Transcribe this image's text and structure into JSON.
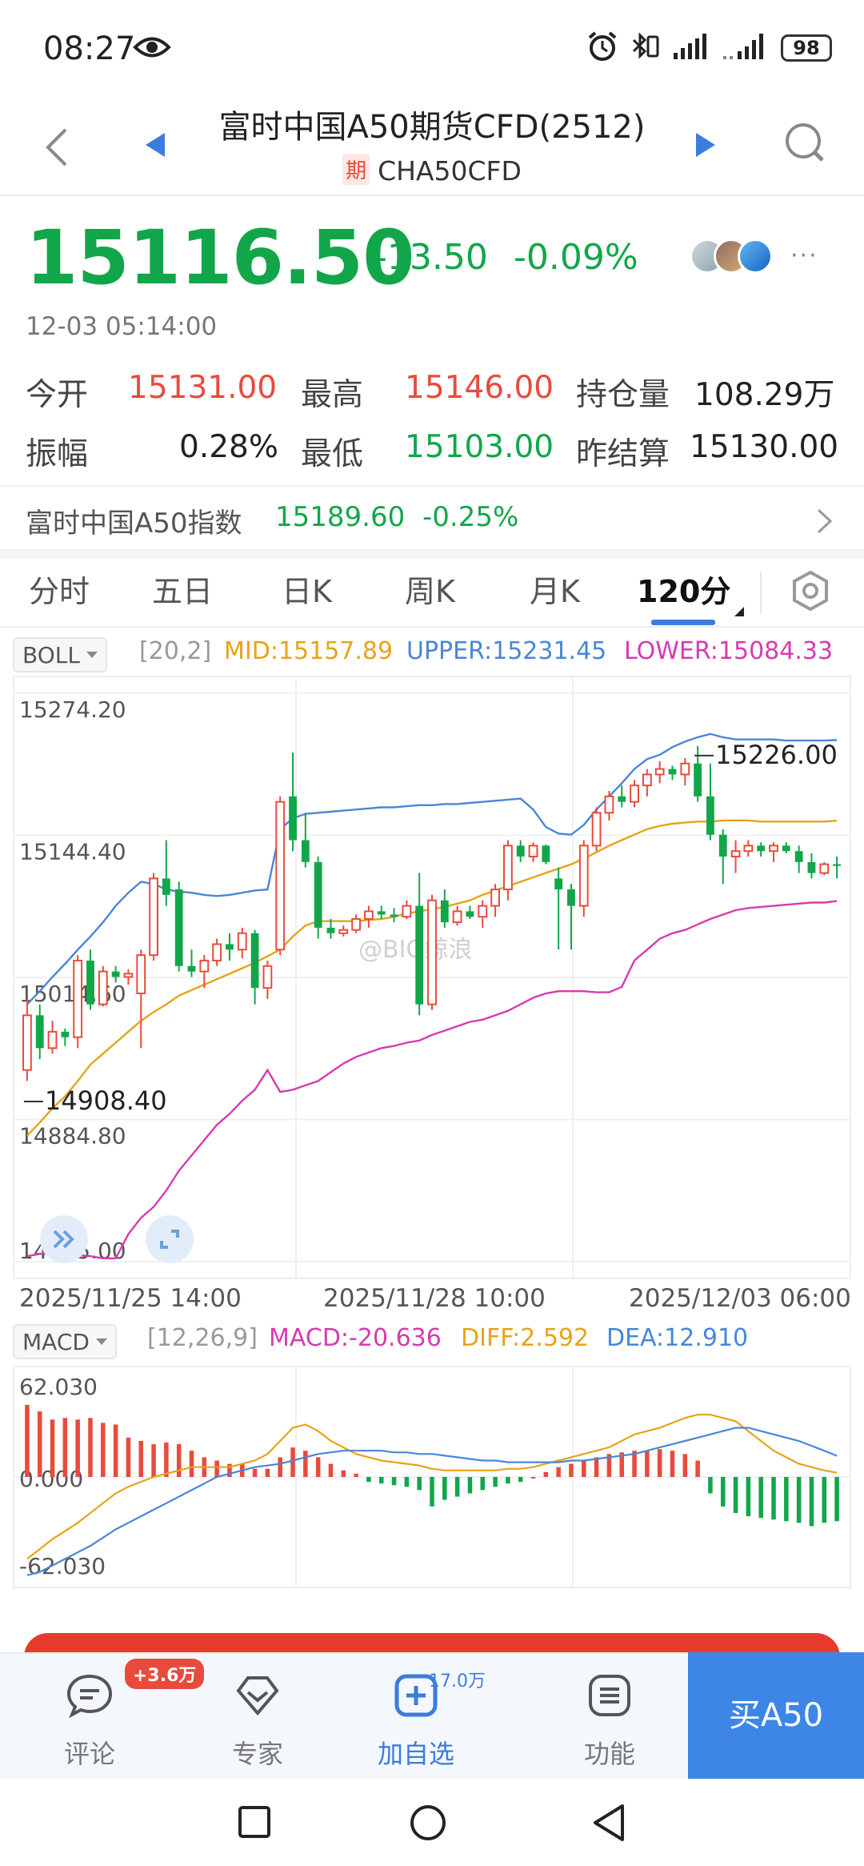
{
  "status_bar": {
    "time": "08:27",
    "battery": "98",
    "icons": [
      "eye-icon",
      "alarm-icon",
      "bluetooth-icon",
      "signal-icon",
      "wifi-icon",
      "battery-icon"
    ]
  },
  "header": {
    "title": "富时中国A50期货CFD(2512)",
    "badge": "期",
    "symbol": "CHA50CFD",
    "icons": [
      "back-arrow-icon",
      "prev-triangle-icon",
      "next-triangle-icon",
      "search-icon"
    ]
  },
  "quote": {
    "price": "15116.50",
    "change": "-13.50",
    "change_pct": "-0.09%",
    "time": "12-03 05:14:00",
    "more": "···"
  },
  "stats": {
    "open_label": "今开",
    "open": "15131.00",
    "high_label": "最高",
    "high": "15146.00",
    "oi_label": "持仓量",
    "oi": "108.29万",
    "amp_label": "振幅",
    "amp": "0.28%",
    "low_label": "最低",
    "low": "15103.00",
    "settle_label": "昨结算",
    "settle": "15130.00"
  },
  "index": {
    "name": "富时中国A50指数",
    "value": "15189.60",
    "pct": "-0.25%"
  },
  "tabs": [
    "分时",
    "五日",
    "日K",
    "周K",
    "月K",
    "120分"
  ],
  "active_tab": "120分",
  "boll": {
    "selector": "BOLL",
    "params": "[20,2]",
    "mid": "MID:15157.89",
    "upper": "UPPER:15231.45",
    "lower": "LOWER:15084.33",
    "y_labels": [
      "15274.20",
      "15144.40",
      "15014.60",
      "14884.80",
      "14755.00"
    ],
    "annotations": {
      "high": "15226.00",
      "low": "14908.40"
    },
    "watermark": "@BIG鲸浪"
  },
  "x_axis": [
    "2025/11/25 14:00",
    "2025/11/28 10:00",
    "2025/12/03 06:00"
  ],
  "macd": {
    "selector": "MACD",
    "params": "[12,26,9]",
    "macd": "MACD:-20.636",
    "diff": "DIFF:2.592",
    "dea": "DEA:12.910",
    "y_labels": [
      "62.030",
      "0.000",
      "-62.030"
    ]
  },
  "colors": {
    "up": "#e84b3c",
    "down": "#11a64a",
    "mid": "#e8a317",
    "upper": "#4a86d8",
    "lower": "#d63bb0",
    "accent": "#3d86e6"
  },
  "chart_data": [
    {
      "type": "candlestick",
      "title": "",
      "ylim": [
        14755.0,
        15274.2
      ],
      "x_ticks": [
        "2025/11/25 14:00",
        "2025/11/28 10:00",
        "2025/12/03 06:00"
      ],
      "candles": [
        [
          14930,
          14995,
          14920,
          14980
        ],
        [
          14980,
          14990,
          14940,
          14950
        ],
        [
          14950,
          14975,
          14945,
          14965
        ],
        [
          14965,
          14968,
          14952,
          14960
        ],
        [
          14960,
          15035,
          14950,
          15030
        ],
        [
          15030,
          15040,
          14985,
          14990
        ],
        [
          14990,
          15025,
          14988,
          15020
        ],
        [
          15020,
          15025,
          15010,
          15015
        ],
        [
          15015,
          15022,
          15008,
          15018
        ],
        [
          15000,
          15040,
          14950,
          15035
        ],
        [
          15035,
          15110,
          15030,
          15105
        ],
        [
          15105,
          15140,
          15080,
          15090
        ],
        [
          15095,
          15102,
          15020,
          15025
        ],
        [
          15025,
          15040,
          15015,
          15020
        ],
        [
          15020,
          15035,
          15005,
          15030
        ],
        [
          15030,
          15050,
          15025,
          15045
        ],
        [
          15045,
          15055,
          15030,
          15040
        ],
        [
          15040,
          15060,
          15032,
          15055
        ],
        [
          15055,
          15058,
          14990,
          15005
        ],
        [
          15005,
          15030,
          14995,
          15025
        ],
        [
          15040,
          15180,
          15035,
          15175
        ],
        [
          15180,
          15220,
          15130,
          15140
        ],
        [
          15140,
          15165,
          15115,
          15120
        ],
        [
          15120,
          15125,
          15050,
          15060
        ],
        [
          15060,
          15068,
          15050,
          15055
        ],
        [
          15055,
          15062,
          15052,
          15058
        ],
        [
          15058,
          15072,
          15055,
          15068
        ],
        [
          15068,
          15080,
          15060,
          15075
        ],
        [
          15075,
          15080,
          15068,
          15072
        ],
        [
          15072,
          15078,
          15065,
          15070
        ],
        [
          15070,
          15085,
          15068,
          15080
        ],
        [
          15080,
          15110,
          14980,
          14990
        ],
        [
          14990,
          15090,
          14985,
          15085
        ],
        [
          15085,
          15095,
          15060,
          15065
        ],
        [
          15065,
          15080,
          15062,
          15075
        ],
        [
          15075,
          15080,
          15068,
          15070
        ],
        [
          15070,
          15085,
          15060,
          15080
        ],
        [
          15080,
          15100,
          15070,
          15095
        ],
        [
          15095,
          15140,
          15085,
          15135
        ],
        [
          15135,
          15140,
          15120,
          15125
        ],
        [
          15125,
          15138,
          15120,
          15135
        ],
        [
          15135,
          15136,
          15118,
          15120
        ],
        [
          15105,
          15115,
          15040,
          15095
        ],
        [
          15095,
          15100,
          15040,
          15080
        ],
        [
          15080,
          15140,
          15070,
          15135
        ],
        [
          15135,
          15170,
          15130,
          15165
        ],
        [
          15165,
          15185,
          15158,
          15180
        ],
        [
          15180,
          15190,
          15170,
          15175
        ],
        [
          15175,
          15195,
          15170,
          15190
        ],
        [
          15190,
          15205,
          15180,
          15200
        ],
        [
          15200,
          15212,
          15192,
          15205
        ],
        [
          15205,
          15208,
          15195,
          15200
        ],
        [
          15200,
          15215,
          15190,
          15210
        ],
        [
          15210,
          15226,
          15175,
          15180
        ],
        [
          15180,
          15210,
          15140,
          15145
        ],
        [
          15145,
          15150,
          15100,
          15125
        ],
        [
          15125,
          15140,
          15110,
          15130
        ],
        [
          15130,
          15140,
          15125,
          15135
        ],
        [
          15135,
          15138,
          15125,
          15130
        ],
        [
          15130,
          15138,
          15120,
          15135
        ],
        [
          15135,
          15138,
          15128,
          15130
        ],
        [
          15130,
          15135,
          15110,
          15120
        ],
        [
          15120,
          15128,
          15105,
          15110
        ],
        [
          15110,
          15120,
          15108,
          15118
        ],
        [
          15118,
          15125,
          15105,
          15116.5
        ]
      ],
      "series": [
        {
          "name": "MID",
          "values": [
            14870,
            14882,
            14895,
            14906,
            14920,
            14935,
            14945,
            14955,
            14965,
            14975,
            14983,
            14990,
            14998,
            15003,
            15008,
            15013,
            15018,
            15023,
            15028,
            15034,
            15040,
            15052,
            15062,
            15066,
            15066,
            15066,
            15066,
            15067,
            15068,
            15070,
            15073,
            15075,
            15077,
            15079,
            15082,
            15085,
            15090,
            15094,
            15098,
            15102,
            15106,
            15110,
            15114,
            15118,
            15123,
            15129,
            15135,
            15140,
            15145,
            15150,
            15153,
            15155,
            15156,
            15157,
            15157,
            15158,
            15158,
            15158,
            15157,
            15157,
            15157,
            15157,
            15157,
            15157,
            15157.89
          ]
        },
        {
          "name": "UPPER",
          "values": [
            14990,
            15002,
            15015,
            15027,
            15040,
            15052,
            15065,
            15080,
            15092,
            15102,
            15100,
            15095,
            15093,
            15092,
            15090,
            15089,
            15090,
            15092,
            15094,
            15095,
            15150,
            15160,
            15164,
            15165,
            15166,
            15167,
            15168,
            15169,
            15170,
            15170,
            15171,
            15172,
            15172,
            15173,
            15173,
            15174,
            15175,
            15176,
            15177,
            15178,
            15168,
            15152,
            15146,
            15145,
            15154,
            15168,
            15180,
            15192,
            15205,
            15214,
            15218,
            15225,
            15230,
            15234,
            15237,
            15234,
            15232,
            15232,
            15232,
            15232,
            15231,
            15231,
            15231,
            15231,
            15231.45
          ]
        },
        {
          "name": "LOWER",
          "values": [
            14760,
            14762,
            14764,
            14762,
            14761,
            14760,
            14758,
            14758,
            14780,
            14795,
            14805,
            14820,
            14838,
            14852,
            14866,
            14880,
            14890,
            14902,
            14912,
            14930,
            14910,
            14912,
            14916,
            14920,
            14928,
            14936,
            14942,
            14946,
            14950,
            14952,
            14955,
            14957,
            14962,
            14966,
            14970,
            14974,
            14976,
            14980,
            14984,
            14990,
            14996,
            15000,
            15002,
            15002,
            15002,
            15001,
            15001,
            15006,
            15030,
            15040,
            15050,
            15055,
            15058,
            15063,
            15068,
            15072,
            15076,
            15078,
            15079,
            15080,
            15081,
            15082,
            15083,
            15083,
            15084.33
          ]
        }
      ]
    },
    {
      "type": "bar",
      "title": "",
      "ylim": [
        -62.03,
        62.03
      ],
      "histogram": [
        44,
        40,
        35,
        36,
        35,
        36,
        33,
        32,
        24,
        22,
        20,
        21,
        20,
        16,
        12,
        10,
        8,
        8,
        5,
        5,
        12,
        18,
        16,
        12,
        8,
        4,
        2,
        -3,
        -4,
        -5,
        -6,
        -8,
        -18,
        -14,
        -12,
        -10,
        -8,
        -6,
        -4,
        -3,
        0,
        3,
        6,
        8,
        10,
        12,
        14,
        15,
        16,
        16,
        17,
        16,
        14,
        10,
        -10,
        -18,
        -22,
        -24,
        -25,
        -26,
        -27,
        -28,
        -30,
        -28,
        -27
      ],
      "series": [
        {
          "name": "DIFF",
          "values": [
            -50,
            -44,
            -38,
            -33,
            -28,
            -22,
            -16,
            -10,
            -6,
            -3,
            0,
            2,
            4,
            6,
            6,
            6,
            6,
            8,
            10,
            14,
            22,
            30,
            32,
            28,
            22,
            18,
            14,
            12,
            10,
            9,
            8,
            7,
            5,
            4,
            4,
            4,
            4,
            4,
            5,
            5,
            6,
            8,
            10,
            12,
            14,
            16,
            18,
            22,
            26,
            28,
            30,
            33,
            36,
            38,
            38,
            36,
            34,
            28,
            22,
            16,
            12,
            8,
            6,
            4,
            2.592
          ]
        },
        {
          "name": "DEA",
          "values": [
            -60,
            -58,
            -54,
            -50,
            -46,
            -42,
            -37,
            -32,
            -28,
            -24,
            -20,
            -16,
            -12,
            -8,
            -4,
            0,
            2,
            4,
            6,
            7,
            8,
            10,
            12,
            14,
            15,
            16,
            16,
            16,
            16,
            15,
            15,
            14,
            14,
            13,
            12,
            11,
            10,
            10,
            9,
            9,
            9,
            9,
            9,
            10,
            10,
            11,
            12,
            13,
            14,
            16,
            18,
            20,
            22,
            24,
            26,
            28,
            30,
            30,
            28,
            26,
            24,
            22,
            19,
            16,
            12.91
          ]
        }
      ]
    }
  ],
  "bottom_bar": {
    "comment_label": "评论",
    "comment_badge": "+3.6万",
    "expert_label": "专家",
    "watch_label": "加自选",
    "watch_count": "17.0万",
    "func_label": "功能",
    "buy_label": "买A50"
  }
}
